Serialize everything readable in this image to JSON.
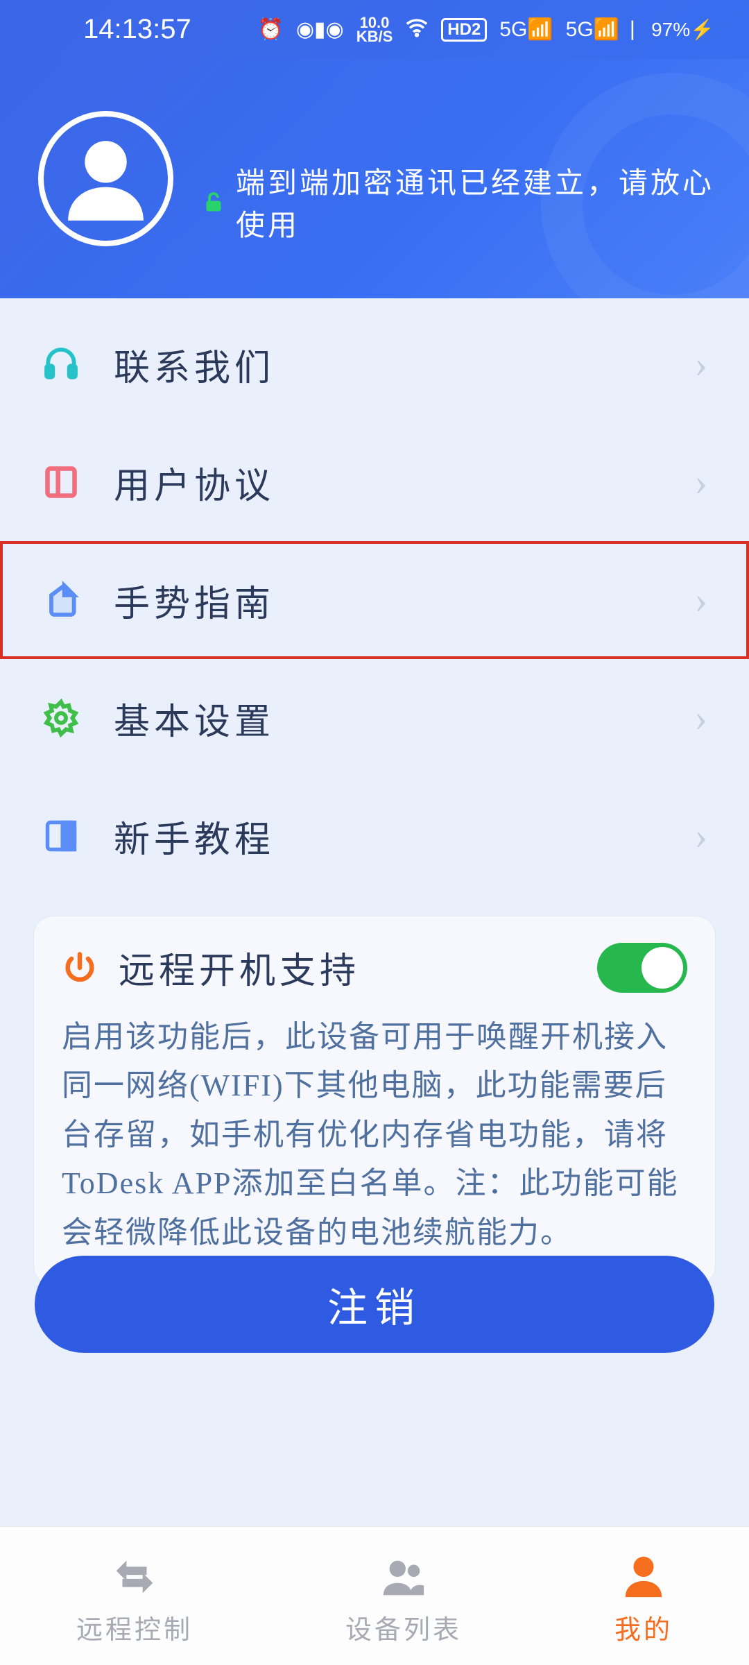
{
  "status": {
    "time": "14:13:57",
    "net_speed_top": "10.0",
    "net_speed_bottom": "KB/S",
    "hd_badge": "HD2",
    "signal1": "5G",
    "signal2": "5G",
    "battery": "97%"
  },
  "header": {
    "banner_text": "端到端加密通讯已经建立，请放心使用"
  },
  "menu": [
    {
      "key": "contact",
      "label": "联系我们",
      "icon": "headset-icon",
      "icon_color": "#26c2c9",
      "highlight": false
    },
    {
      "key": "agreement",
      "label": "用户协议",
      "icon": "document-icon",
      "icon_color": "#f06e7e",
      "highlight": false
    },
    {
      "key": "gesture",
      "label": "手势指南",
      "icon": "gesture-icon",
      "icon_color": "#5a8df5",
      "highlight": true
    },
    {
      "key": "settings",
      "label": "基本设置",
      "icon": "gear-icon",
      "icon_color": "#3fbf4a",
      "highlight": false
    },
    {
      "key": "tutorial",
      "label": "新手教程",
      "icon": "book-icon",
      "icon_color": "#5a8df5",
      "highlight": false
    }
  ],
  "panel": {
    "title": "远程开机支持",
    "toggle_on": true,
    "description": "启用该功能后，此设备可用于唤醒开机接入同一网络(WIFI)下其他电脑，此功能需要后台存留，如手机有优化内存省电功能，请将ToDesk APP添加至白名单。注：此功能可能会轻微降低此设备的电池续航能力。"
  },
  "logout_label": "注销",
  "nav": [
    {
      "key": "remote",
      "label": "远程控制",
      "active": false
    },
    {
      "key": "devices",
      "label": "设备列表",
      "active": false
    },
    {
      "key": "mine",
      "label": "我的",
      "active": true
    }
  ]
}
